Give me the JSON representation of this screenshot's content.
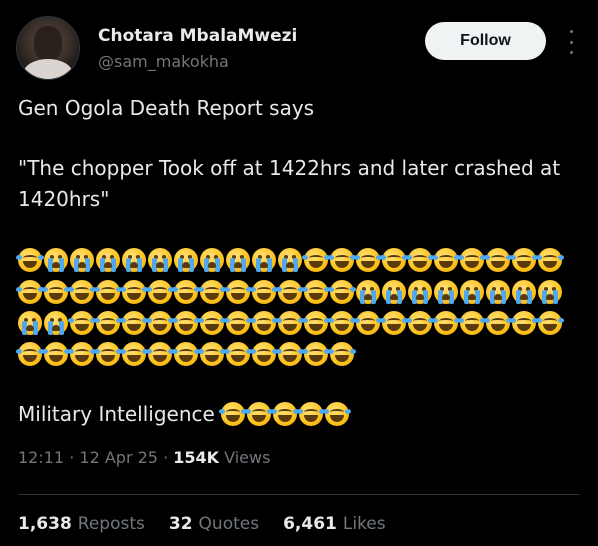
{
  "author": {
    "name": "Chotara MbalaMwezi",
    "handle": "@sam_makokha"
  },
  "follow_label": "Follow",
  "tweet": {
    "line1": "Gen Ogola Death Report says",
    "line2": "\"The chopper Took off at 1422hrs and later crashed at",
    "line3": "1420hrs\"",
    "emoji_rows": [
      [
        "joy",
        "cry",
        "cry",
        "cry",
        "cry",
        "cry",
        "cry",
        "cry",
        "cry",
        "cry",
        "cry",
        "joy",
        "joy",
        "joy",
        "joy",
        "joy",
        "joy",
        "joy",
        "joy",
        "joy",
        "joy"
      ],
      [
        "joy",
        "joy",
        "joy",
        "joy",
        "joy",
        "joy",
        "joy",
        "joy",
        "joy",
        "joy",
        "joy",
        "joy",
        "joy",
        "cry",
        "cry",
        "cry",
        "cry",
        "cry",
        "cry",
        "cry",
        "cry"
      ],
      [
        "cry",
        "cry",
        "joy",
        "joy",
        "joy",
        "joy",
        "joy",
        "joy",
        "joy",
        "joy",
        "joy",
        "joy",
        "joy",
        "joy",
        "joy",
        "joy",
        "joy",
        "joy",
        "joy",
        "joy",
        "joy"
      ],
      [
        "joy",
        "joy",
        "joy",
        "joy",
        "joy",
        "joy",
        "joy",
        "joy",
        "joy",
        "joy",
        "joy",
        "joy",
        "joy"
      ]
    ],
    "footer_text": "Military Intelligence",
    "footer_emojis": [
      "joy",
      "joy",
      "joy",
      "joy",
      "joy"
    ]
  },
  "meta": {
    "time": "12:11",
    "date": "12 Apr 25",
    "views": "154K",
    "views_label": "Views"
  },
  "stats": {
    "reposts": "1,638",
    "reposts_label": "Reposts",
    "quotes": "32",
    "quotes_label": "Quotes",
    "likes": "6,461",
    "likes_label": "Likes"
  }
}
